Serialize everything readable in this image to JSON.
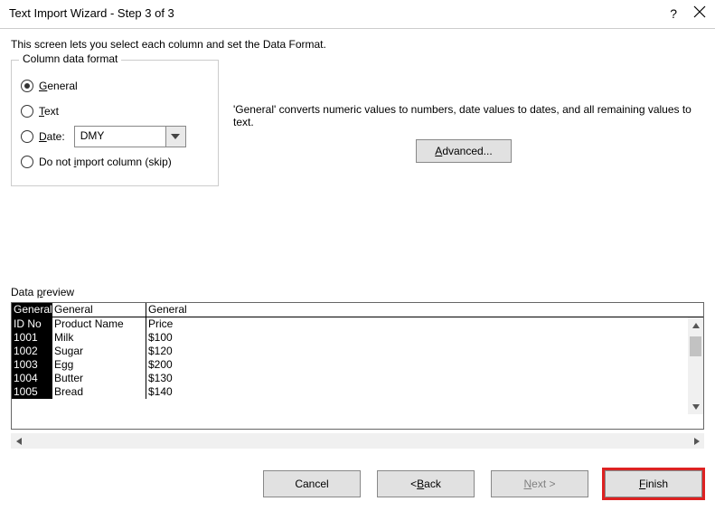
{
  "title": "Text Import Wizard - Step 3 of 3",
  "intro": "This screen lets you select each column and set the Data Format.",
  "group_label": "Column data format",
  "radios": {
    "general": "General",
    "text": "Text",
    "date": "Date:",
    "skip": "Do not import column (skip)"
  },
  "date_value": "DMY",
  "description": "'General' converts numeric values to numbers, date values to dates, and all remaining values to text.",
  "advanced_label": "Advanced...",
  "preview_label": "Data preview",
  "columns": [
    "General",
    "General",
    "General"
  ],
  "rows": [
    [
      "ID No",
      "Product Name",
      "Price"
    ],
    [
      "1001",
      "Milk",
      "$100"
    ],
    [
      "1002",
      "Sugar",
      "$120"
    ],
    [
      "1003",
      "Egg",
      "$200"
    ],
    [
      "1004",
      "Butter",
      "$130"
    ],
    [
      "1005",
      "Bread",
      "$140"
    ]
  ],
  "buttons": {
    "cancel": "Cancel",
    "back": "< Back",
    "next": "Next >",
    "finish": "Finish"
  }
}
